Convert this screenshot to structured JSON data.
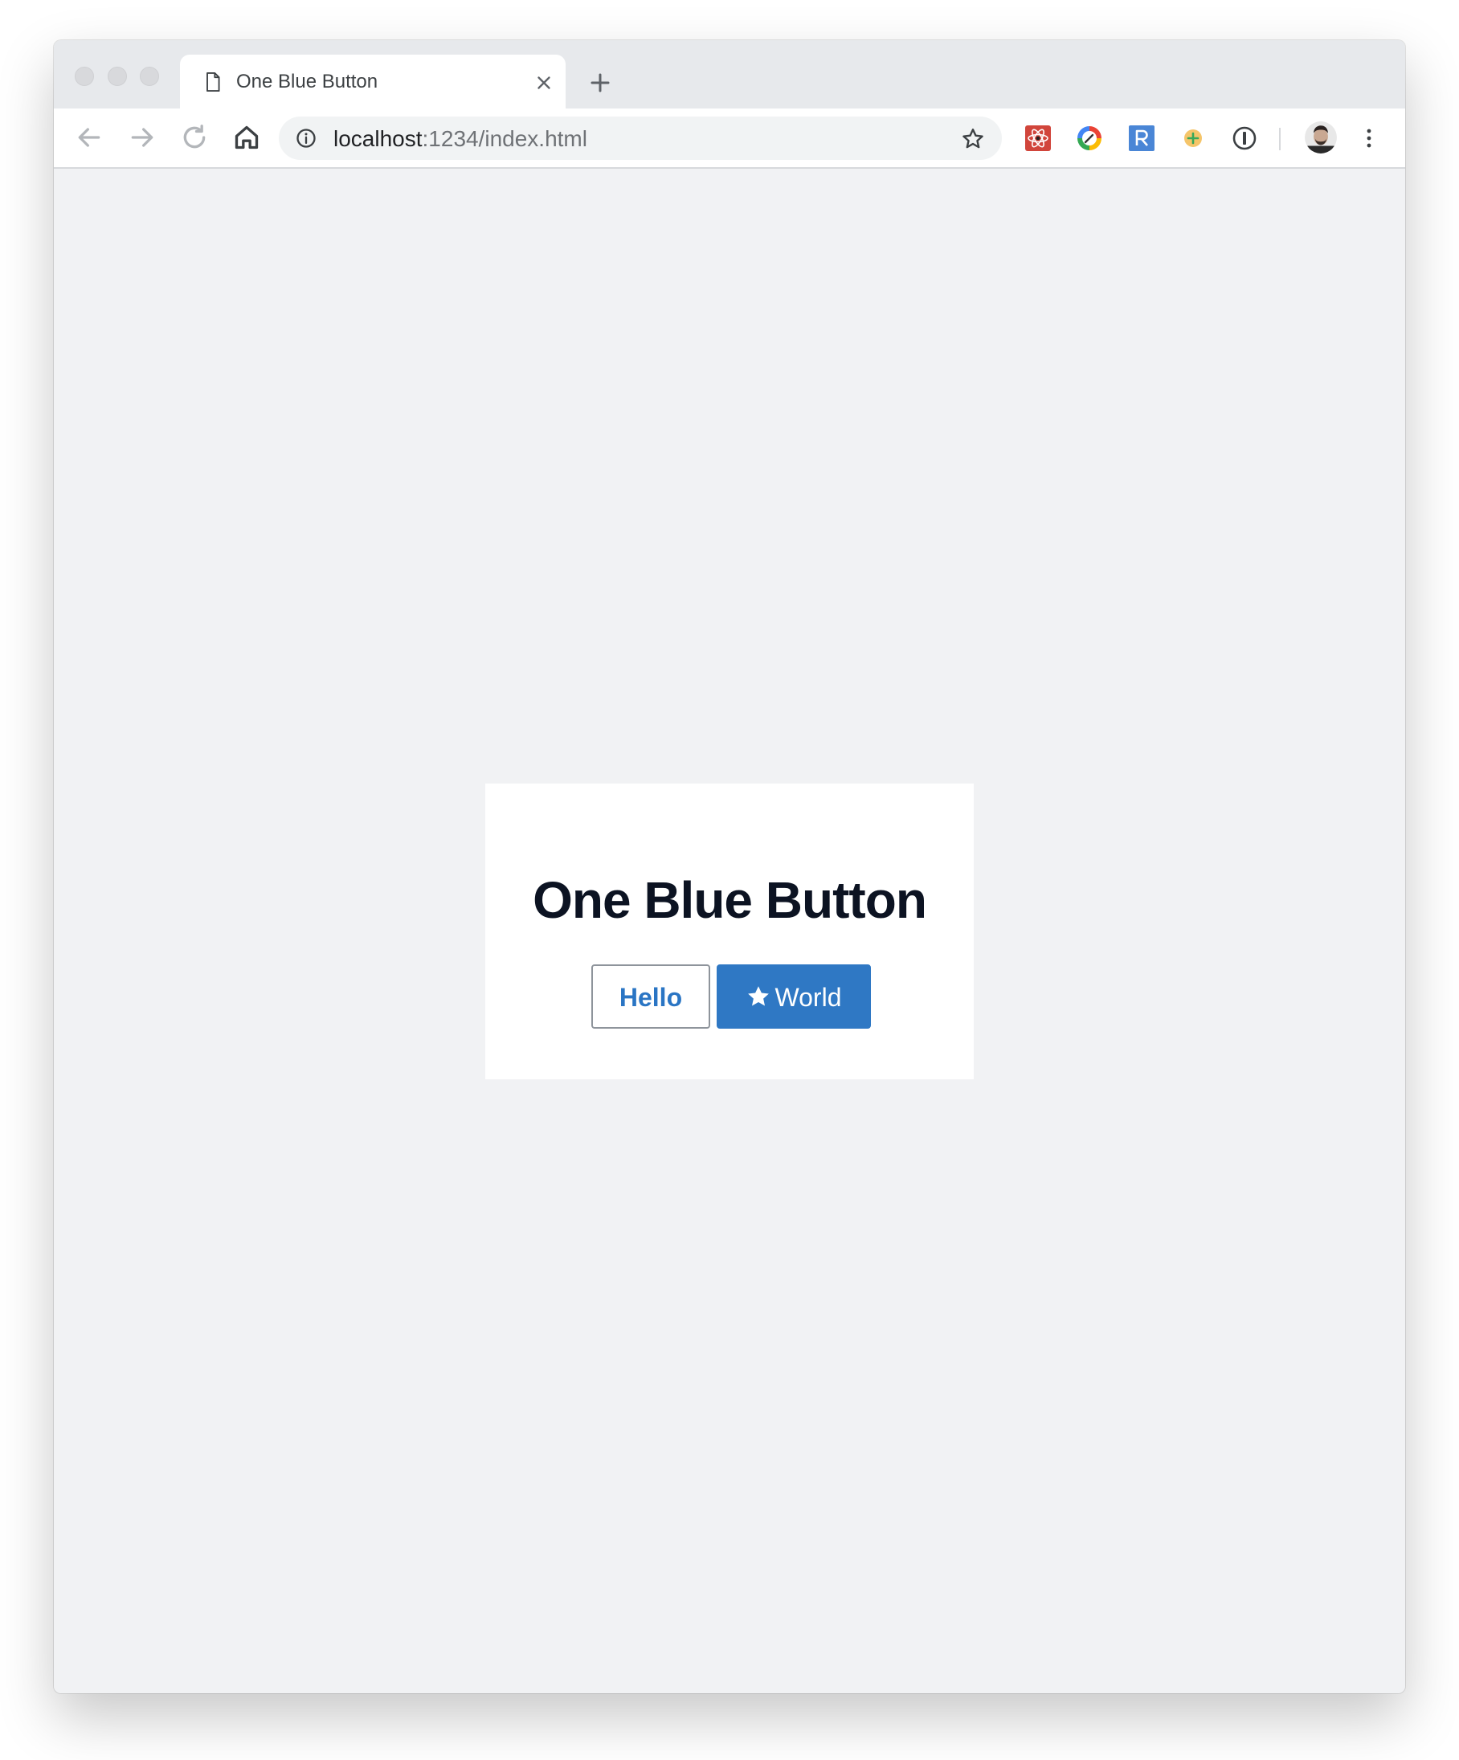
{
  "browser": {
    "tab": {
      "title": "One Blue Button",
      "icon": "document-icon"
    },
    "address_bar": {
      "host": "localhost",
      "path": ":1234/index.html",
      "info_icon": "info-icon",
      "bookmark_icon": "star-outline-icon"
    },
    "toolbar_icons": [
      "back-arrow-icon",
      "forward-arrow-icon",
      "reload-icon",
      "home-icon"
    ],
    "extension_icons": [
      "react-devtools-icon",
      "color-picker-extension-icon",
      "r-extension-icon",
      "plus-extension-icon",
      "password-manager-icon"
    ],
    "profile_icon": "avatar-icon",
    "menu_icon": "kebab-menu-icon"
  },
  "page": {
    "heading": "One Blue Button",
    "buttons": {
      "hello_label": "Hello",
      "world_label": "World",
      "world_icon": "star-icon"
    },
    "colors": {
      "primary": "#2f78c4",
      "heading": "#0c1322",
      "background": "#f1f2f4"
    }
  }
}
